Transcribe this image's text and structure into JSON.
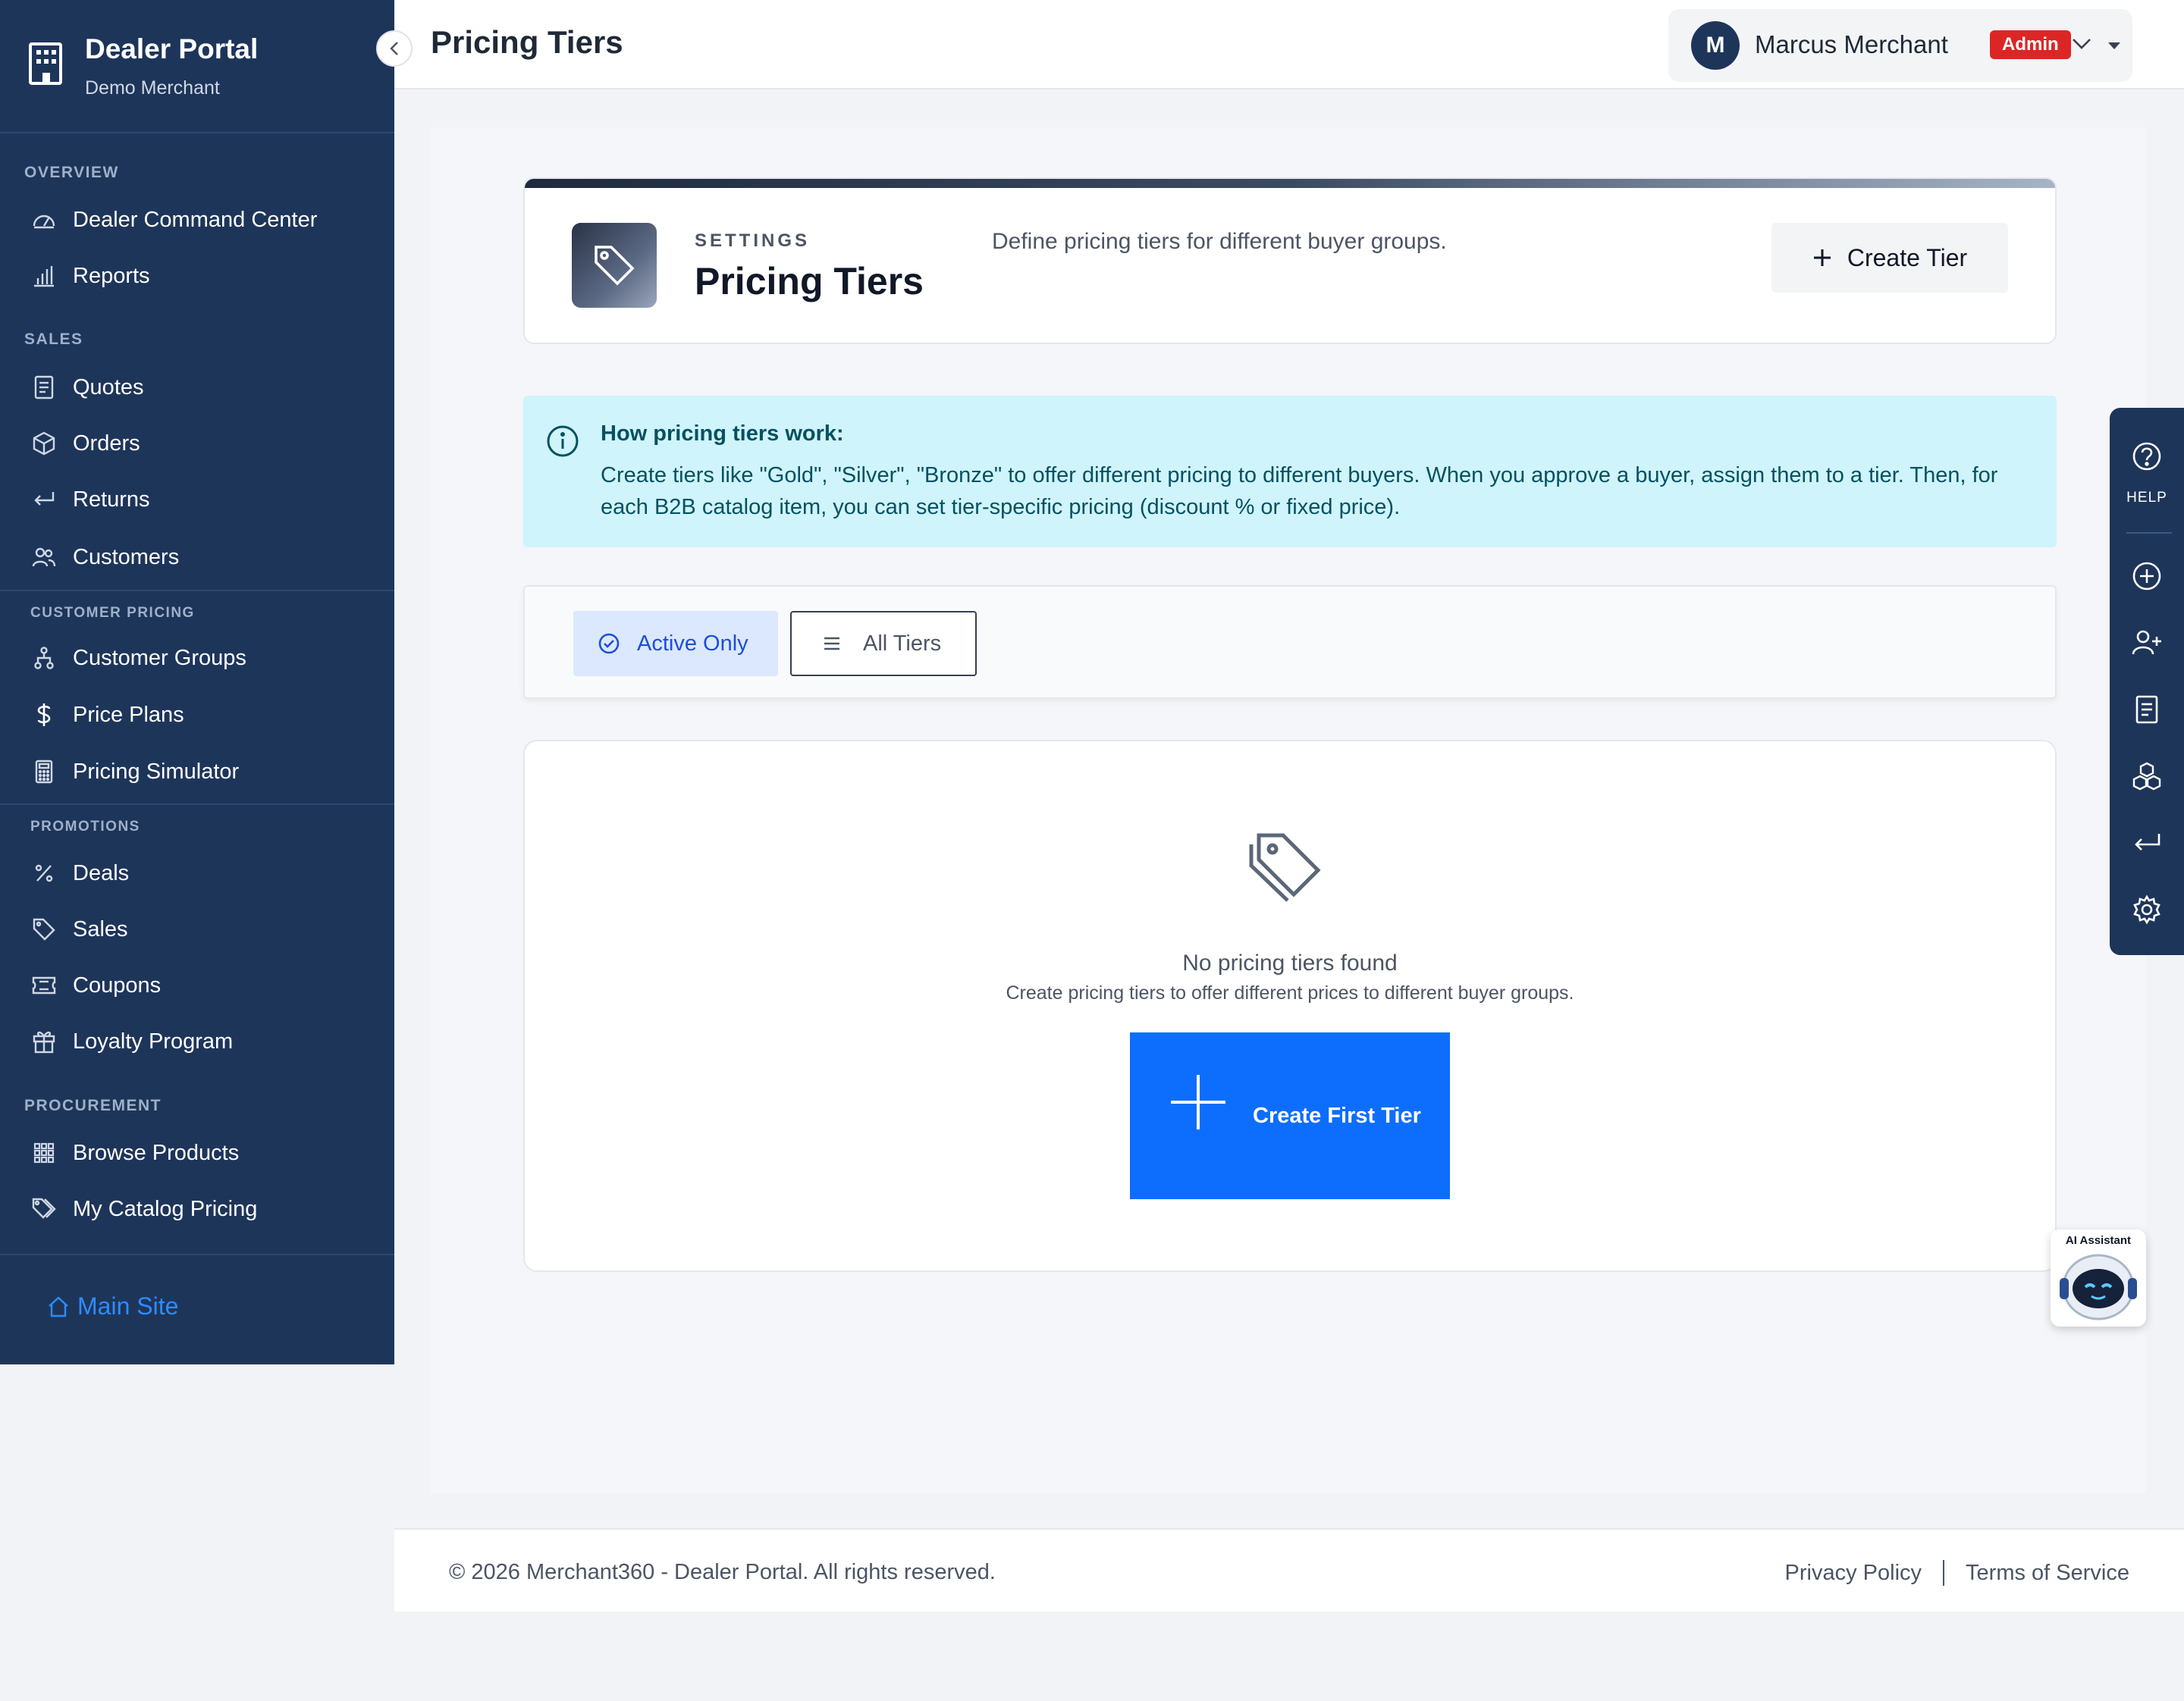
{
  "sidebar": {
    "brand_title": "Dealer Portal",
    "brand_subtitle": "Demo Merchant",
    "sections": {
      "overview": "OVERVIEW",
      "sales": "SALES",
      "customer_pricing": "CUSTOMER PRICING",
      "promotions": "PROMOTIONS",
      "procurement": "PROCUREMENT"
    },
    "items": {
      "dealer_command_center": "Dealer Command Center",
      "reports": "Reports",
      "quotes": "Quotes",
      "orders": "Orders",
      "returns": "Returns",
      "customers": "Customers",
      "customer_groups": "Customer Groups",
      "price_plans": "Price Plans",
      "pricing_simulator": "Pricing Simulator",
      "deals": "Deals",
      "sales": "Sales",
      "coupons": "Coupons",
      "loyalty_program": "Loyalty Program",
      "browse_products": "Browse Products",
      "my_catalog_pricing": "My Catalog Pricing"
    },
    "main_site": "Main Site"
  },
  "topbar": {
    "page_title": "Pricing Tiers",
    "user_initial": "M",
    "user_name": "Marcus Merchant",
    "role": "Admin"
  },
  "header_card": {
    "kicker": "SETTINGS",
    "title": "Pricing Tiers",
    "description": "Define pricing tiers for different buyer groups.",
    "create_button": "Create Tier"
  },
  "info": {
    "heading": "How pricing tiers work:",
    "text": "Create tiers like \"Gold\", \"Silver\", \"Bronze\" to offer different pricing to different buyers. When you approve a buyer, assign them to a tier. Then, for each B2B catalog item, you can set tier-specific pricing (discount % or fixed price)."
  },
  "filters": {
    "active_only": "Active Only",
    "all_tiers": "All Tiers"
  },
  "empty_state": {
    "title": "No pricing tiers found",
    "subtitle": "Create pricing tiers to offer different prices to different buyer groups.",
    "button": "Create First Tier"
  },
  "help_rail": {
    "help_label": "HELP"
  },
  "ai_assistant": {
    "label": "AI Assistant"
  },
  "footer": {
    "copyright": "© 2026 Merchant360 - Dealer Portal. All rights reserved.",
    "privacy": "Privacy Policy",
    "terms": "Terms of Service"
  },
  "colors": {
    "sidebar_bg": "#1e355a",
    "primary": "#0d6efd",
    "admin_badge": "#dc2626",
    "info_bg": "#cff4fc"
  }
}
